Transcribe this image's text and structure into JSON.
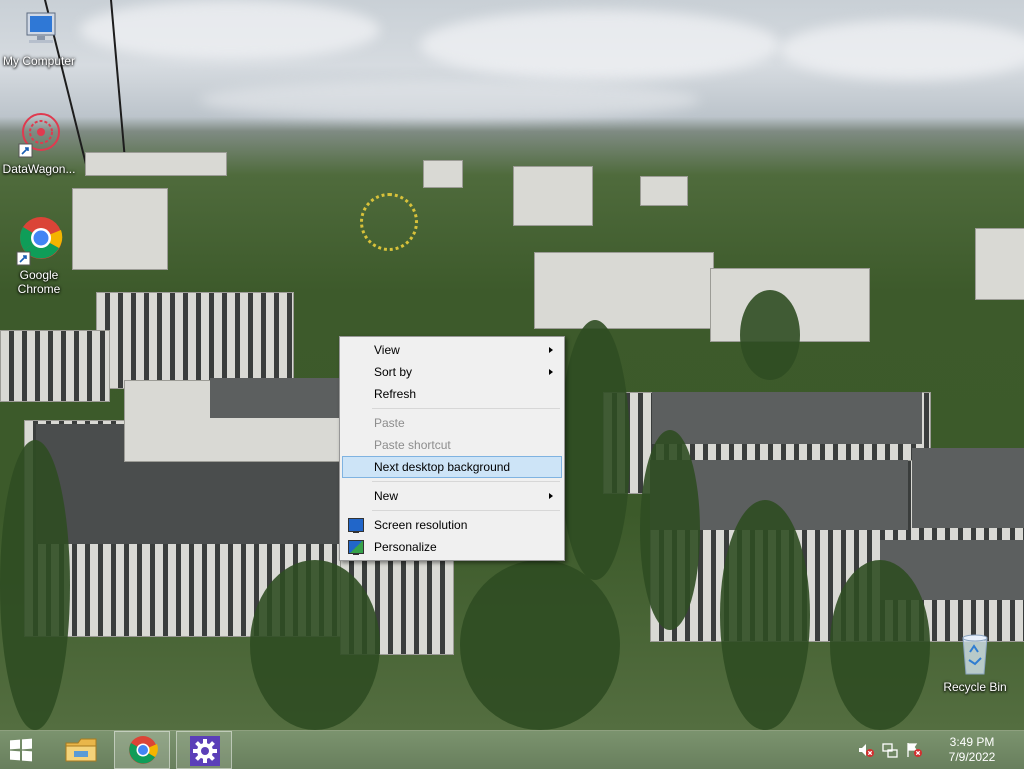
{
  "desktop": {
    "icons": [
      {
        "label": "My Computer",
        "glyph": "computer-icon"
      },
      {
        "label": "DataWagon...",
        "glyph": "datawagon-icon"
      },
      {
        "label": "Google Chrome",
        "glyph": "chrome-icon"
      },
      {
        "label": "Recycle Bin",
        "glyph": "recycle-bin-icon"
      }
    ]
  },
  "context_menu": {
    "items": [
      {
        "label": "View",
        "submenu": true
      },
      {
        "label": "Sort by",
        "submenu": true
      },
      {
        "label": "Refresh"
      },
      {
        "label": "Paste",
        "disabled": true
      },
      {
        "label": "Paste shortcut",
        "disabled": true
      },
      {
        "label": "Next desktop background",
        "highlighted": true
      },
      {
        "label": "New",
        "submenu": true
      },
      {
        "label": "Screen resolution",
        "icon": "screen-resolution-icon"
      },
      {
        "label": "Personalize",
        "icon": "personalize-icon"
      }
    ]
  },
  "taskbar": {
    "start_icon": "windows-logo-icon",
    "pinned": [
      "file-explorer-icon",
      "chrome-icon",
      "settings-gear-icon"
    ],
    "tray_icons": [
      "volume-muted-icon",
      "network-icon",
      "action-center-flag-icon"
    ],
    "clock": {
      "time": "3:49 PM",
      "date": "7/9/2022"
    }
  },
  "colors": {
    "menu_highlight": "#cde4f7",
    "menu_highlight_border": "#7fb3e1",
    "settings_button": "#5b3fb8"
  }
}
